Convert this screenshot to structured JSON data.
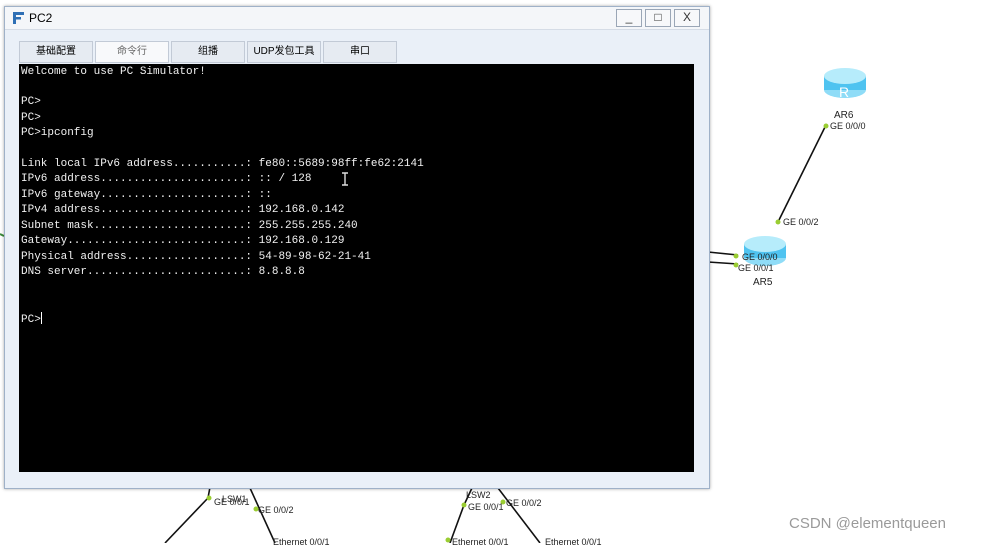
{
  "window": {
    "title": "PC2",
    "controls": {
      "minimize": "_",
      "maximize": "□",
      "close": "X"
    },
    "tabs": [
      {
        "label": "基础配置"
      },
      {
        "label": "命令行"
      },
      {
        "label": "组播"
      },
      {
        "label": "UDP发包工具"
      },
      {
        "label": "串口"
      }
    ],
    "active_tab": "命令行"
  },
  "terminal": {
    "lines": [
      "Welcome to use PC Simulator!",
      "",
      "PC>",
      "PC>",
      "PC>ipconfig",
      "",
      "Link local IPv6 address...........: fe80::5689:98ff:fe62:2141",
      "IPv6 address......................: :: / 128",
      "IPv6 gateway......................: ::",
      "IPv4 address......................: 192.168.0.142",
      "Subnet mask.......................: 255.255.255.240",
      "Gateway...........................: 192.168.0.129",
      "Physical address..................: 54-89-98-62-21-41",
      "DNS server........................: 8.8.8.8",
      "",
      "",
      "PC>"
    ]
  },
  "topology": {
    "devices": [
      {
        "name": "AR6"
      },
      {
        "name": "AR5"
      },
      {
        "name": "LSW1"
      },
      {
        "name": "LSW2"
      }
    ],
    "ports": {
      "ar6_ge000": "GE 0/0/0",
      "ar5_ge002": "GE 0/0/2",
      "ar5_ge000": "GE 0/0/0",
      "ar5_ge001": "GE 0/0/1",
      "lsw1_ge001": "GE 0/0/1",
      "lsw1_ge002": "GE 0/0/2",
      "lsw2_ge001": "GE 0/0/1",
      "lsw2_ge002": "GE 0/0/2",
      "lsw2_eth001": "Ethernet 0/0/1",
      "lsw1_eth": "Ethernet 0/0/1",
      "lsw2_eth": "Ethernet 0/0/1"
    },
    "router_glyph": "R"
  },
  "watermark": "CSDN @elementqueen",
  "colors": {
    "router_fill": "#4fc3f0",
    "port_dot": "#9acd32",
    "terminal_bg": "#000000",
    "terminal_text": "#f2f2f2"
  }
}
